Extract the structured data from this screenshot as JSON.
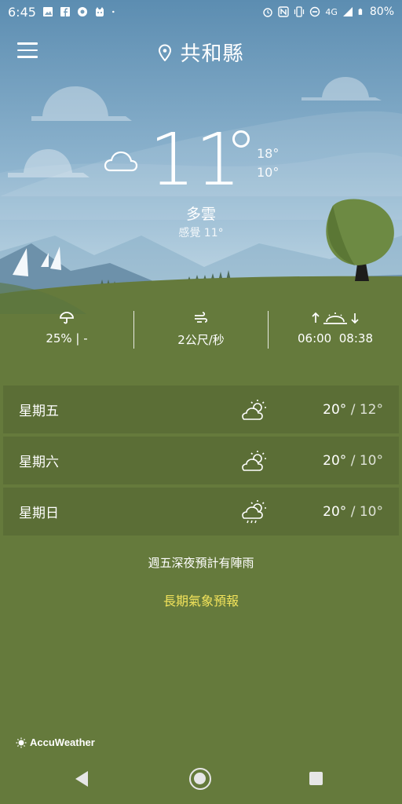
{
  "status_bar": {
    "time": "6:45",
    "network": "4G",
    "battery": "80%",
    "icons": [
      "gallery-icon",
      "facebook-icon",
      "chrome-icon",
      "cat-app-icon",
      "dot-icon",
      "alarm-icon",
      "nfc-icon",
      "vibrate-icon",
      "dnd-icon",
      "signal-icon",
      "battery-icon"
    ]
  },
  "header": {
    "location": "共和縣",
    "icons": [
      "menu-icon",
      "location-pin-icon"
    ]
  },
  "current": {
    "temperature": "11",
    "high": "18°",
    "low": "10°",
    "condition": "多雲",
    "feels_like": "感覺 11°",
    "icon": "cloud-icon"
  },
  "details": {
    "precipitation": "25% | -",
    "wind": "2公尺/秒",
    "sunrise": "06:00",
    "sunset": "08:38",
    "icons": [
      "umbrella-icon",
      "wind-icon",
      "sunrise-sunset-icon"
    ]
  },
  "forecast": [
    {
      "day": "星期五",
      "high": "20°",
      "low": "12°",
      "icon": "partly-sunny-icon"
    },
    {
      "day": "星期六",
      "high": "20°",
      "low": "10°",
      "icon": "partly-sunny-icon"
    },
    {
      "day": "星期日",
      "high": "20°",
      "low": "10°",
      "icon": "partly-sunny-rain-icon"
    }
  ],
  "temp_separator": " / ",
  "summary": "週五深夜預計有陣雨",
  "extended_forecast_link": "長期氣象預報",
  "brand": "AccuWeather",
  "colors": {
    "sky_top": "#5d8fb3",
    "sky_bottom": "#c6dbe6",
    "ground": "#657a3c",
    "row_background": "#5b6e36",
    "link": "#f2e35b",
    "tree": "#6d8a43"
  }
}
